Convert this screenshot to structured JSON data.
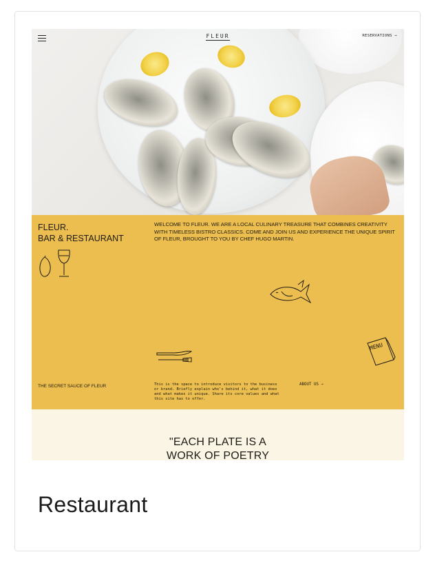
{
  "card": {
    "title": "Restaurant"
  },
  "site": {
    "logo": "FLEUR",
    "reservations": "RESERVATIONS",
    "reservations_arrow": "→",
    "brand_line1": "FLEUR.",
    "brand_line2": "BAR & RESTAURANT",
    "welcome": "WELCOME TO FLEUR. WE ARE A LOCAL CULINARY TREASURE THAT COMBINES CREATIVITY WITH TIMELESS BISTRO CLASSICS. COME AND JOIN US AND EXPERIENCE THE UNIQUE SPIRIT OF FLEUR, BROUGHT TO YOU BY CHEF HUGO MARTIN.",
    "secret": "THE SECRET SAUCE OF FLEUR",
    "intro": "This is the space to introduce visitors to the business or brand. Briefly explain who's behind it, what it does and what makes it unique. Share its core values and what this site has to offer.",
    "about": "ABOUT US",
    "about_arrow": "→",
    "menu_sketch_text": "MENU",
    "quote_line1": "\"EACH PLATE IS A",
    "quote_line2": "WORK OF POETRY"
  },
  "colors": {
    "yellow": "#ecbe4f",
    "cream": "#fbf5e6",
    "ink": "#1e1a12",
    "card_border": "#dfe3e8"
  },
  "icons": [
    "menu-icon",
    "arrow-right-icon",
    "lemon-sketch-icon",
    "wine-glass-sketch-icon",
    "fish-sketch-icon",
    "cutlery-sketch-icon",
    "menu-card-sketch-icon"
  ]
}
